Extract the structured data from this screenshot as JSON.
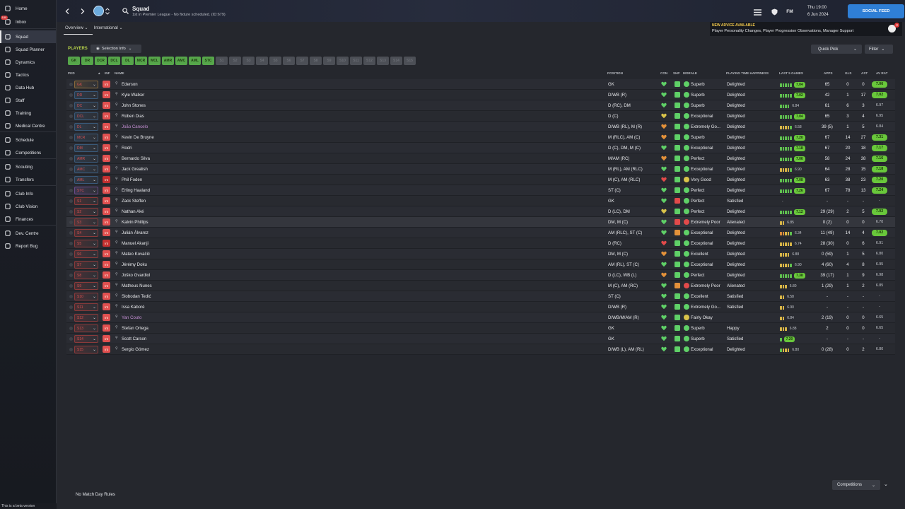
{
  "app": {
    "beta_text": "This is a beta version"
  },
  "sidebar": {
    "items": [
      {
        "label": "Home",
        "icon": "home-icon",
        "badge": ""
      },
      {
        "label": "Inbox",
        "icon": "inbox-icon",
        "badge": "180"
      },
      {
        "label": "Squad",
        "icon": "squad-icon",
        "badge": ""
      },
      {
        "label": "Squad Planner",
        "icon": "squad-planner-icon",
        "badge": ""
      },
      {
        "label": "Dynamics",
        "icon": "dynamics-icon",
        "badge": ""
      },
      {
        "label": "Tactics",
        "icon": "tactics-icon",
        "badge": ""
      },
      {
        "label": "Data Hub",
        "icon": "data-hub-icon",
        "badge": ""
      },
      {
        "label": "Staff",
        "icon": "staff-icon",
        "badge": ""
      },
      {
        "label": "Training",
        "icon": "training-icon",
        "badge": ""
      },
      {
        "label": "Medical Centre",
        "icon": "medical-icon",
        "badge": ""
      },
      {
        "label": "Schedule",
        "icon": "schedule-icon",
        "badge": ""
      },
      {
        "label": "Competitions",
        "icon": "trophy-icon",
        "badge": ""
      },
      {
        "label": "Scouting",
        "icon": "scouting-icon",
        "badge": ""
      },
      {
        "label": "Transfers",
        "icon": "transfers-icon",
        "badge": ""
      },
      {
        "label": "Club Info",
        "icon": "club-info-icon",
        "badge": ""
      },
      {
        "label": "Club Vision",
        "icon": "club-vision-icon",
        "badge": ""
      },
      {
        "label": "Finances",
        "icon": "finances-icon",
        "badge": ""
      },
      {
        "label": "Dev. Centre",
        "icon": "dev-centre-icon",
        "badge": ""
      },
      {
        "label": "Report Bug",
        "icon": "report-bug-icon",
        "badge": ""
      }
    ]
  },
  "header": {
    "title": "Squad",
    "subtitle": "1st in Premier League - No fixture scheduled. (ID:679)",
    "day_time": "Thu 19:00",
    "date": "6 Jun 2024",
    "fm_label": "FM",
    "social_feed": "SOCIAL FEED"
  },
  "advice": {
    "heading": "NEW ADVICE AVAILABLE",
    "body": "Player Personality Changes, Player Progression Observations, Manager Support",
    "count": "3"
  },
  "tabs": [
    {
      "label": "Overview"
    },
    {
      "label": "International"
    }
  ],
  "toolbar": {
    "players_label": "PLAYERS",
    "selection_info": "Selection Info",
    "quick_pick": "Quick Pick",
    "filter": "Filter"
  },
  "position_filters": [
    {
      "label": "GK",
      "on": true
    },
    {
      "label": "DR",
      "on": true
    },
    {
      "label": "DCR",
      "on": true
    },
    {
      "label": "DCL",
      "on": true
    },
    {
      "label": "DL",
      "on": true
    },
    {
      "label": "MCR",
      "on": true
    },
    {
      "label": "MCL",
      "on": true
    },
    {
      "label": "AMR",
      "on": true
    },
    {
      "label": "AMC",
      "on": true
    },
    {
      "label": "AML",
      "on": true
    },
    {
      "label": "STC",
      "on": true
    },
    {
      "label": "S1",
      "on": false
    },
    {
      "label": "S2",
      "on": false
    },
    {
      "label": "S3",
      "on": false
    },
    {
      "label": "S4",
      "on": false
    },
    {
      "label": "S5",
      "on": false
    },
    {
      "label": "S6",
      "on": false
    },
    {
      "label": "S7",
      "on": false
    },
    {
      "label": "S8",
      "on": false
    },
    {
      "label": "S9",
      "on": false
    },
    {
      "label": "S10",
      "on": false
    },
    {
      "label": "S11",
      "on": false
    },
    {
      "label": "S12",
      "on": false
    },
    {
      "label": "S13",
      "on": false
    },
    {
      "label": "S14",
      "on": false
    },
    {
      "label": "S15",
      "on": false
    }
  ],
  "table": {
    "headers": {
      "pkd": "PKD",
      "inf": "INF",
      "name": "NAME",
      "position": "POSITION",
      "con": "CON",
      "shp": "SHP",
      "morale": "MORALE",
      "pth": "PLAYING TIME HAPPINESS",
      "last5": "LAST 5 GAMES",
      "apps": "APPS",
      "gls": "GLS",
      "ast": "AST",
      "avrat": "AV RAT"
    },
    "rows": [
      {
        "sel": "GK",
        "inf": "Int",
        "name": "Ederson",
        "position": "GK",
        "con": "green",
        "shp": "green",
        "morale_c": "green",
        "morale": "Superb",
        "pth": "Delighted",
        "form": "ggggg",
        "last5": "7.04",
        "apps": "65",
        "gls": "0",
        "ast": "0",
        "avrat": "7.06",
        "avgood": true,
        "selcol": "#8a6a3a"
      },
      {
        "sel": "DR",
        "inf": "Int",
        "name": "Kyle Walker",
        "position": "D/WB (R)",
        "con": "green",
        "shp": "green",
        "morale_c": "green",
        "morale": "Superb",
        "pth": "Delighted",
        "form": "ggggg",
        "last5": "7.02",
        "apps": "42",
        "gls": "1",
        "ast": "17",
        "avrat": "7.02",
        "avgood": true,
        "selcol": "#3a5a7a"
      },
      {
        "sel": "DC",
        "inf": "Int",
        "name": "John Stones",
        "position": "D (RC), DM",
        "con": "green",
        "shp": "green",
        "morale_c": "green",
        "morale": "Superb",
        "pth": "Delighted",
        "form": "gggg",
        "last5": "6.84",
        "apps": "61",
        "gls": "6",
        "ast": "3",
        "avrat": "6.97",
        "avgood": false,
        "selcol": "#3a5a7a"
      },
      {
        "sel": "DCL",
        "inf": "Int",
        "name": "Rúben Dias",
        "position": "D (C)",
        "con": "yellow",
        "shp": "green",
        "morale_c": "green",
        "morale": "Exceptional",
        "pth": "Delighted",
        "form": "ggggg",
        "last5": "7.04",
        "apps": "65",
        "gls": "3",
        "ast": "4",
        "avrat": "6.95",
        "avgood": false,
        "selcol": "#3a5a7a"
      },
      {
        "sel": "DL",
        "inf": "Int",
        "name": "João Cancelo",
        "loan": true,
        "position": "D/WB (RL), M (R)",
        "con": "orange",
        "shp": "green",
        "morale_c": "green",
        "morale": "Extremely Go...",
        "pth": "Delighted",
        "form": "yyyyg",
        "last5": "6.58",
        "apps": "39 (5)",
        "gls": "1",
        "ast": "5",
        "avrat": "6.84",
        "avgood": false,
        "selcol": "#3a5a7a"
      },
      {
        "sel": "MCR",
        "inf": "Int",
        "name": "Kevin De Bruyne",
        "position": "M (RLC), AM (C)",
        "con": "orange",
        "shp": "green",
        "morale_c": "green",
        "morale": "Superb",
        "pth": "Delighted",
        "form": "ggggg",
        "last5": "7.20",
        "apps": "67",
        "gls": "14",
        "ast": "27",
        "avrat": "7.31",
        "avgood": true,
        "selcol": "#3a5a7a"
      },
      {
        "sel": "DM",
        "inf": "Int",
        "name": "Rodri",
        "position": "D (C), DM, M (C)",
        "con": "green",
        "shp": "green",
        "morale_c": "green",
        "morale": "Exceptional",
        "pth": "Delighted",
        "form": "ggggg",
        "last5": "7.18",
        "apps": "67",
        "gls": "20",
        "ast": "18",
        "avrat": "7.17",
        "avgood": true,
        "selcol": "#3a5a7a"
      },
      {
        "sel": "AMR",
        "inf": "Int",
        "name": "Bernardo Silva",
        "position": "M/AM (RC)",
        "con": "orange",
        "shp": "green",
        "morale_c": "green",
        "morale": "Perfect",
        "pth": "Delighted",
        "form": "ggggg",
        "last5": "7.06",
        "apps": "58",
        "gls": "24",
        "ast": "38",
        "avrat": "7.16",
        "avgood": true,
        "selcol": "#3a5a7a"
      },
      {
        "sel": "AMC",
        "inf": "Int",
        "name": "Jack Grealish",
        "position": "M (RL), AM (RLC)",
        "con": "green",
        "shp": "green",
        "morale_c": "green",
        "morale": "Exceptional",
        "pth": "Delighted",
        "form": "yyyyg",
        "last5": "6.90",
        "apps": "64",
        "gls": "28",
        "ast": "15",
        "avrat": "7.18",
        "avgood": true,
        "selcol": "#3a5a7a"
      },
      {
        "sel": "AML",
        "inf": "Int",
        "name": "Phil Foden",
        "position": "M (C), AM (RLC)",
        "con": "red",
        "shp": "green",
        "morale_c": "yellow",
        "morale": "Very Good",
        "pth": "Delighted",
        "form": "ggggg",
        "last5": "7.08",
        "apps": "63",
        "gls": "38",
        "ast": "23",
        "avrat": "7.20",
        "avgood": true,
        "selcol": "#3a5a7a",
        "infred": true
      },
      {
        "sel": "STC",
        "inf": "Int",
        "name": "Erling Haaland",
        "position": "ST (C)",
        "con": "green",
        "shp": "green",
        "morale_c": "green",
        "morale": "Perfect",
        "pth": "Delighted",
        "form": "ggggg",
        "last5": "7.26",
        "apps": "67",
        "gls": "78",
        "ast": "13",
        "avrat": "7.24",
        "avgood": true,
        "selcol": "#6a4a8a"
      },
      {
        "sel": "S1",
        "inf": "Int",
        "name": "Zack Steffen",
        "position": "GK",
        "con": "green",
        "shp": "red",
        "morale_c": "green",
        "morale": "Perfect",
        "pth": "Satisfied",
        "form": "",
        "last5": "-",
        "apps": "-",
        "gls": "-",
        "ast": "-",
        "avrat": "-",
        "avgood": false,
        "selcol": "#8a3a3a"
      },
      {
        "sel": "S2",
        "inf": "Int",
        "name": "Nathan Aké",
        "position": "D (LC), DM",
        "con": "yellow",
        "shp": "green",
        "morale_c": "green",
        "morale": "Perfect",
        "pth": "Delighted",
        "form": "ggggg",
        "last5": "7.12",
        "apps": "29 (29)",
        "gls": "2",
        "ast": "5",
        "avrat": "7.02",
        "avgood": true,
        "selcol": "#8a3a3a"
      },
      {
        "sel": "S3",
        "inf": "Int",
        "name": "Kalvin Phillips",
        "position": "DM, M (C)",
        "con": "green",
        "shp": "red",
        "morale_c": "red",
        "morale": "Extremely Poor",
        "pth": "Alienated",
        "form": "yy",
        "last5": "6.85",
        "apps": "0 (2)",
        "gls": "0",
        "ast": "0",
        "avrat": "6.70",
        "avgood": false,
        "selcol": "#8a3a3a",
        "hl": true
      },
      {
        "sel": "S4",
        "inf": "Int",
        "name": "Julián Álvarez",
        "position": "AM (RLC), ST (C)",
        "con": "green",
        "shp": "orange",
        "morale_c": "green",
        "morale": "Exceptional",
        "pth": "Delighted",
        "form": "ooyyg",
        "last5": "6.34",
        "apps": "11 (49)",
        "gls": "14",
        "ast": "4",
        "avrat": "7.02",
        "avgood": true,
        "selcol": "#8a3a3a"
      },
      {
        "sel": "S5",
        "inf": "Int",
        "name": "Manuel Akanji",
        "position": "D (RC)",
        "con": "red",
        "shp": "green",
        "morale_c": "green",
        "morale": "Exceptional",
        "pth": "Delighted",
        "form": "yyyyy",
        "last5": "6.74",
        "apps": "28 (30)",
        "gls": "0",
        "ast": "6",
        "avrat": "6.91",
        "avgood": false,
        "selcol": "#8a3a3a",
        "infred": true
      },
      {
        "sel": "S6",
        "inf": "Int",
        "name": "Mateo Kovačić",
        "position": "DM, M (C)",
        "con": "orange",
        "shp": "green",
        "morale_c": "green",
        "morale": "Excellent",
        "pth": "Delighted",
        "form": "yyyy",
        "last5": "6.88",
        "apps": "0 (59)",
        "gls": "1",
        "ast": "5",
        "avrat": "6.80",
        "avgood": false,
        "selcol": "#8a3a3a"
      },
      {
        "sel": "S7",
        "inf": "Int",
        "name": "Jérémy Doku",
        "position": "AM (RL), ST (C)",
        "con": "green",
        "shp": "green",
        "morale_c": "green",
        "morale": "Exceptional",
        "pth": "Delighted",
        "form": "yyyyg",
        "last5": "6.90",
        "apps": "4 (60)",
        "gls": "4",
        "ast": "8",
        "avrat": "6.95",
        "avgood": false,
        "selcol": "#8a3a3a"
      },
      {
        "sel": "S8",
        "inf": "Int",
        "name": "Joško Gvardiol",
        "position": "D (LC), WB (L)",
        "con": "orange",
        "shp": "green",
        "morale_c": "green",
        "morale": "Perfect",
        "pth": "Delighted",
        "form": "ggggg",
        "last5": "7.38",
        "apps": "39 (17)",
        "gls": "1",
        "ast": "9",
        "avrat": "6.98",
        "avgood": false,
        "selcol": "#8a3a3a"
      },
      {
        "sel": "S9",
        "inf": "Int",
        "name": "Matheus Nunes",
        "position": "M (C), AM (RC)",
        "con": "green",
        "shp": "orange",
        "morale_c": "red",
        "morale": "Extremely Poor",
        "pth": "Alienated",
        "form": "yyy",
        "last5": "6.80",
        "apps": "1 (29)",
        "gls": "1",
        "ast": "2",
        "avrat": "6.85",
        "avgood": false,
        "selcol": "#8a3a3a"
      },
      {
        "sel": "S10",
        "inf": "Int",
        "name": "Slobodan Tedić",
        "position": "ST (C)",
        "con": "green",
        "shp": "green",
        "morale_c": "green",
        "morale": "Excellent",
        "pth": "Satisfied",
        "form": "yy",
        "last5": "6.58",
        "apps": "-",
        "gls": "-",
        "ast": "-",
        "avrat": "-",
        "avgood": false,
        "selcol": "#8a3a3a"
      },
      {
        "sel": "S11",
        "inf": "Int",
        "name": "Issa Kaboré",
        "position": "D/WB (R)",
        "con": "green",
        "shp": "green",
        "morale_c": "green",
        "morale": "Extremely Go...",
        "pth": "Satisfied",
        "form": "yy",
        "last5": "6.90",
        "apps": "-",
        "gls": "-",
        "ast": "-",
        "avrat": "-",
        "avgood": false,
        "selcol": "#8a3a3a"
      },
      {
        "sel": "S12",
        "inf": "Int",
        "name": "Yan Couto",
        "loan": true,
        "position": "D/WB/M/AM (R)",
        "con": "green",
        "shp": "green",
        "morale_c": "yellow",
        "morale": "Fairly Okay",
        "pth": "",
        "form": "yy",
        "last5": "6.84",
        "apps": "2 (19)",
        "gls": "0",
        "ast": "0",
        "avrat": "6.65",
        "avgood": false,
        "selcol": "#8a3a3a"
      },
      {
        "sel": "S13",
        "inf": "Int",
        "name": "Stefan Ortega",
        "position": "GK",
        "con": "green",
        "shp": "green",
        "morale_c": "green",
        "morale": "Superb",
        "pth": "Happy",
        "form": "yyy",
        "last5": "6.88",
        "apps": "2",
        "gls": "0",
        "ast": "0",
        "avrat": "6.65",
        "avgood": false,
        "selcol": "#8a3a3a"
      },
      {
        "sel": "S14",
        "inf": "Int",
        "name": "Scott Carson",
        "position": "GK",
        "con": "green",
        "shp": "green",
        "morale_c": "green",
        "morale": "Superb",
        "pth": "Satisfied",
        "form": "g",
        "last5": "7.20",
        "apps": "-",
        "gls": "-",
        "ast": "-",
        "avrat": "-",
        "avgood": false,
        "selcol": "#8a3a3a"
      },
      {
        "sel": "S15",
        "inf": "Int",
        "name": "Sergio Gómez",
        "position": "D/WB (L), AM (RL)",
        "con": "green",
        "shp": "green",
        "morale_c": "green",
        "morale": "Exceptional",
        "pth": "Delighted",
        "form": "gyyy",
        "last5": "6.80",
        "apps": "0 (28)",
        "gls": "0",
        "ast": "2",
        "avrat": "6.80",
        "avgood": false,
        "selcol": "#8a3a3a"
      }
    ]
  },
  "footer": {
    "no_match_day_rules": "No Match Day Rules",
    "competitions": "Competitions"
  },
  "colors": {
    "accent_green": "#69c83b",
    "social_blue": "#2f7fd6",
    "players_label": "#b5d14a"
  }
}
